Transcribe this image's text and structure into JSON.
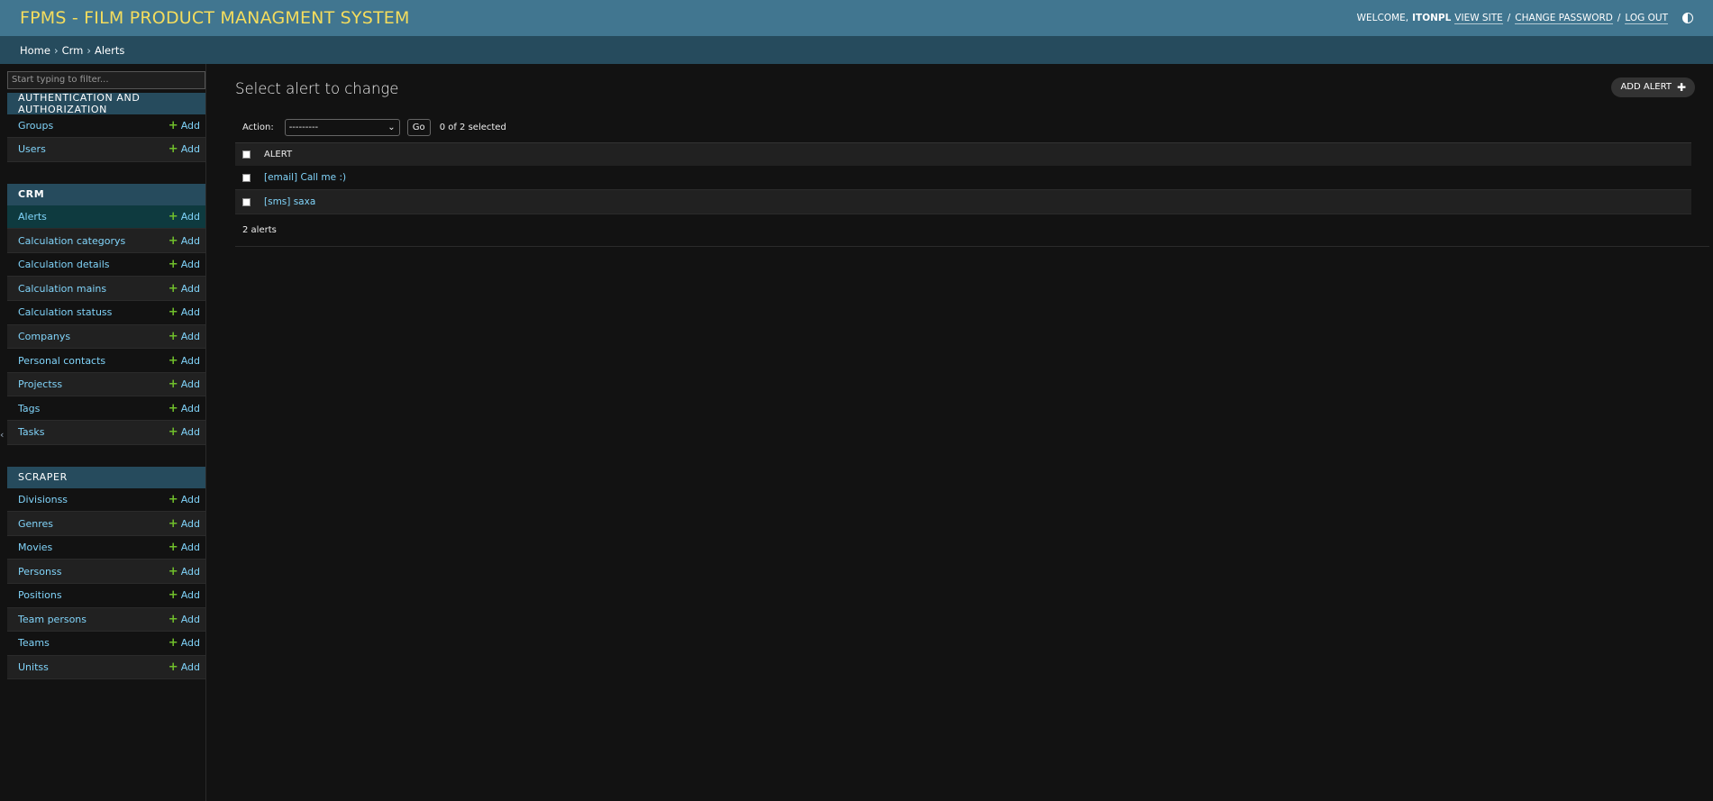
{
  "header": {
    "branding": "FPMS - FILM PRODUCT MANAGMENT SYSTEM",
    "welcome": "WELCOME,",
    "username": "ITONPL",
    "view_site": "VIEW SITE",
    "change_password": "CHANGE PASSWORD",
    "log_out": "LOG OUT",
    "separator": "/"
  },
  "breadcrumbs": {
    "home": "Home",
    "app": "Crm",
    "current": "Alerts",
    "separator": "›"
  },
  "sidebar": {
    "filter_placeholder": "Start typing to filter...",
    "add_label": "Add",
    "modules": [
      {
        "caption": "AUTHENTICATION AND AUTHORIZATION",
        "models": [
          "Groups",
          "Users"
        ]
      },
      {
        "caption": "CRM",
        "models": [
          "Alerts",
          "Calculation categorys",
          "Calculation details",
          "Calculation mains",
          "Calculation statuss",
          "Companys",
          "Personal contacts",
          "Projectss",
          "Tags",
          "Tasks"
        ]
      },
      {
        "caption": "SCRAPER",
        "models": [
          "Divisionss",
          "Genres",
          "Movies",
          "Personss",
          "Positions",
          "Team persons",
          "Teams",
          "Unitss"
        ]
      }
    ]
  },
  "content": {
    "title": "Select alert to change",
    "add_button": "ADD ALERT",
    "action_label": "Action:",
    "action_selected": "---------",
    "go_label": "Go",
    "selected_count": "0 of 2 selected",
    "column_header": "ALERT",
    "rows": [
      "[email] Call me :)",
      "[sms] saxa"
    ],
    "paginator": "2 alerts"
  },
  "colors": {
    "header_bg": "#417690",
    "branding": "#f5dd5d",
    "breadcrumbs_bg": "#264b5d",
    "link": "#81d4fa",
    "add_plus": "#70bf2b",
    "selected_row": "#0e3a3f"
  }
}
